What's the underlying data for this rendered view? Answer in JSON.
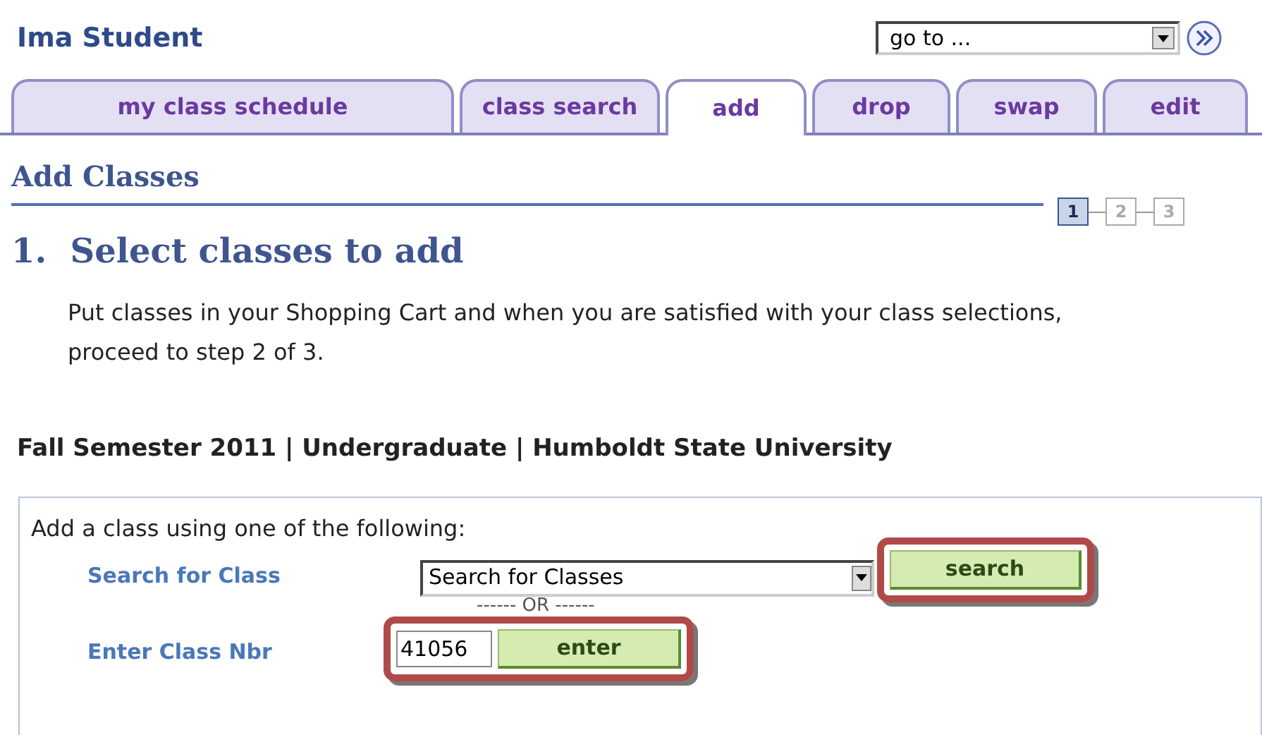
{
  "header": {
    "user_name": "Ima Student",
    "goto": {
      "value": "go to ..."
    }
  },
  "tabs": [
    {
      "label": "my class schedule",
      "selected": false
    },
    {
      "label": "class search",
      "selected": false
    },
    {
      "label": "add",
      "selected": true
    },
    {
      "label": "drop",
      "selected": false
    },
    {
      "label": "swap",
      "selected": false
    },
    {
      "label": "edit",
      "selected": false
    }
  ],
  "page_title": "Add Classes",
  "steps": [
    {
      "label": "1",
      "selected": true
    },
    {
      "label": "2",
      "selected": false
    },
    {
      "label": "3",
      "selected": false
    }
  ],
  "step_heading": "1.  Select classes to add",
  "instructions": "Put classes in your Shopping Cart and when you are satisfied with your class selections, proceed to step 2 of 3.",
  "term": "Fall Semester 2011 | Undergraduate | Humboldt State University",
  "add_panel": {
    "intro": "Add a class using one of the following:",
    "search_label": "Search for Class",
    "search_select": "Search for Classes",
    "search_button": {
      "label": "search",
      "highlighted": true
    },
    "or_text": "------ OR ------",
    "nbr_label": "Enter Class Nbr",
    "nbr_value": "41056",
    "enter_button": {
      "label": "enter",
      "highlighted": true
    }
  }
}
